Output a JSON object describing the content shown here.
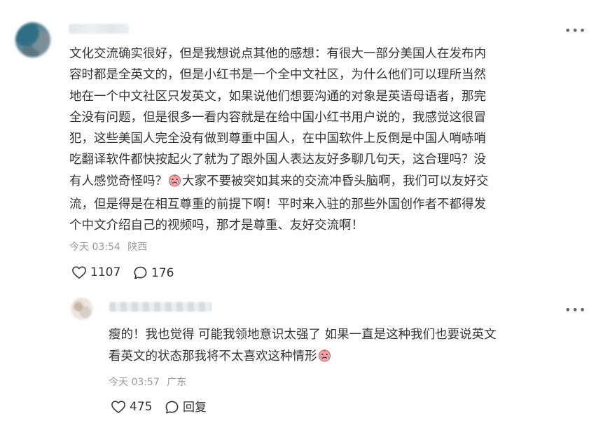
{
  "comment": {
    "text_part1": "文化交流确实很好，但是我想说点其他的感想：有很大一部分美国人在发布内\n容时都是全英文的，但是小红书是一个全中文社区，为什么他们可以理所当然\n地在一个中文社区只发英文，如果说他们想要沟通的对象是英语母语者，那完\n全没有问题，但是很多一看内容就是在给中国小红书用户说的，我感觉这很冒\n犯，这些美国人完全没有做到尊重中国人，在中国软件上反倒是中国人哨哧哨\n吃翻译软件都快按起火了就为了跟外国人表达友好多聊几句天，这合理吗？没\n有人感觉奇怪吗？",
    "text_emoji": "crying-face-emoji",
    "text_part2": "大家不要被突如其来的交流冲昏头脑啊，我们可以友好交\n流，但是得是在相互尊重的前提下啊！平时来入驻的那些外国创作者不都得发\n个中文介绍自己的视频吗，那才是尊重、友好交流啊！",
    "time": "今天 03:54",
    "location": "陕西",
    "likes": "1107",
    "replies": "176",
    "more_icon": "more-horizontal-icon"
  },
  "reply": {
    "text_part1": "瘦的！我也觉得 可能我领地意识太强了 如果一直是这种我们也要说英文\n看英文的状态那我将不太喜欢这种情形",
    "text_emoji": "crying-face-emoji",
    "time": "今天 03:57",
    "location": "广东",
    "likes": "475",
    "reply_label": "回复",
    "more_icon": "more-horizontal-icon"
  },
  "colors": {
    "text": "#333333",
    "meta": "#9a9a9a",
    "emoji_face": "#f28b8b"
  }
}
